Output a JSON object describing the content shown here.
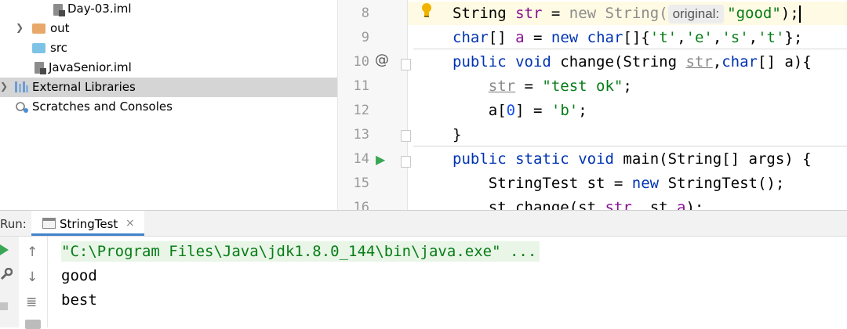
{
  "project_tree": {
    "items": [
      {
        "label": "Day-03.iml",
        "icon": "iml-file-icon"
      },
      {
        "label": "out",
        "icon": "folder-out-icon"
      },
      {
        "label": "src",
        "icon": "folder-src-icon"
      },
      {
        "label": "JavaSenior.iml",
        "icon": "iml-file-icon"
      },
      {
        "label": "External Libraries",
        "icon": "libraries-icon"
      },
      {
        "label": "Scratches and Consoles",
        "icon": "scratches-icon"
      }
    ]
  },
  "editor": {
    "line_numbers": [
      "8",
      "9",
      "10",
      "11",
      "12",
      "13",
      "14",
      "15",
      "16"
    ],
    "gutter_marks": {
      "override": "@",
      "run": "▶",
      "bulb": "bulb-icon"
    },
    "lines": {
      "l8": {
        "kw1": "String",
        "fld": "str",
        "eq": " = ",
        "new": "new",
        "type": " String(",
        "hint": "original:",
        "str": "\"good\"",
        "end": ");"
      },
      "l9": {
        "kw": "char",
        "a": "[] ",
        "fld": "a",
        "b": " = ",
        "new": "new",
        "c": " ",
        "kw2": "char",
        "d": "[]{",
        "s1": "'t'",
        "cm1": ",",
        "s2": "'e'",
        "cm2": ",",
        "s3": "'s'",
        "cm3": ",",
        "s4": "'t'",
        "end": "};"
      },
      "l10": {
        "kw1": "public",
        "kw2": "void",
        "name": " change(String ",
        "p1": "str",
        "c": ",",
        "kw3": "char",
        "rest": "[] a){"
      },
      "l11": {
        "p": "str",
        "eq": " = ",
        "str": "\"test ok\"",
        "end": ";"
      },
      "l12": {
        "a": "a[",
        "num": "0",
        "b": "] = ",
        "str": "'b'",
        "end": ";"
      },
      "l13": {
        "text": "}"
      },
      "l14": {
        "kw1": "public",
        "kw2": "static",
        "kw3": "void",
        "rest": " main(String[] args) {"
      },
      "l15": {
        "a": "StringTest st = ",
        "new": "new",
        "b": " StringTest();"
      },
      "l16": {
        "a": "st.change(st.",
        "f1": "str",
        "b": ", st.",
        "f2": "a",
        "c": ");"
      }
    }
  },
  "run": {
    "label": "Run:",
    "tab_label": "StringTest",
    "tab_close": "×",
    "output": [
      "\"C:\\Program Files\\Java\\jdk1.8.0_144\\bin\\java.exe\" ...",
      "good",
      "best"
    ]
  }
}
